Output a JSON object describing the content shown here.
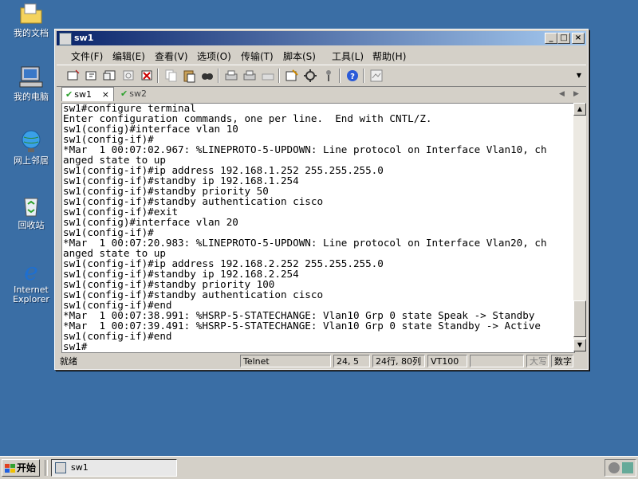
{
  "desktop": {
    "icons": [
      {
        "label": "我的文档",
        "icon": "folder-documents-icon"
      },
      {
        "label": "我的电脑",
        "icon": "computer-icon"
      },
      {
        "label": "网上邻居",
        "icon": "network-icon"
      },
      {
        "label": "回收站",
        "icon": "recycle-bin-icon"
      },
      {
        "label_line1": "Internet",
        "label_line2": "Explorer",
        "icon": "internet-explorer-icon"
      }
    ]
  },
  "window": {
    "title": "sw1",
    "controls": {
      "minimize": "_",
      "maximize": "□",
      "close": "×"
    },
    "menu": [
      "文件(F)",
      "编辑(E)",
      "查看(V)",
      "选项(O)",
      "传输(T)",
      "脚本(S)",
      "工具(L)",
      "帮助(H)"
    ],
    "tabs": [
      {
        "label": "sw1",
        "close": "×",
        "active": true
      },
      {
        "label": "sw2",
        "active": false
      }
    ],
    "tab_nav": {
      "prev": "◀",
      "next": "▶"
    },
    "terminal": {
      "lines": [
        "sw1#configure terminal",
        "Enter configuration commands, one per line.  End with CNTL/Z.",
        "sw1(config)#interface vlan 10",
        "sw1(config-if)#",
        "*Mar  1 00:07:02.967: %LINEPROTO-5-UPDOWN: Line protocol on Interface Vlan10, ch",
        "anged state to up",
        "sw1(config-if)#ip address 192.168.1.252 255.255.255.0",
        "sw1(config-if)#standby ip 192.168.1.254",
        "sw1(config-if)#standby priority 50",
        "sw1(config-if)#standby authentication cisco",
        "sw1(config-if)#exit",
        "sw1(config)#interface vlan 20",
        "sw1(config-if)#",
        "*Mar  1 00:07:20.983: %LINEPROTO-5-UPDOWN: Line protocol on Interface Vlan20, ch",
        "anged state to up",
        "sw1(config-if)#ip address 192.168.2.252 255.255.255.0",
        "sw1(config-if)#standby ip 192.168.2.254",
        "sw1(config-if)#standby priority 100",
        "sw1(config-if)#standby authentication cisco",
        "sw1(config-if)#end",
        "*Mar  1 00:07:38.991: %HSRP-5-STATECHANGE: Vlan10 Grp 0 state Speak -> Standby",
        "*Mar  1 00:07:39.491: %HSRP-5-STATECHANGE: Vlan10 Grp 0 state Standby -> Active",
        "sw1(config-if)#end",
        "sw1#"
      ]
    },
    "status": {
      "ready": "就绪",
      "protocol": "Telnet",
      "cursor": "24,  5",
      "size": "24行, 80列",
      "emulation": "VT100",
      "caps": "大写",
      "num": "数字"
    }
  },
  "taskbar": {
    "start": "开始",
    "task": "sw1"
  }
}
